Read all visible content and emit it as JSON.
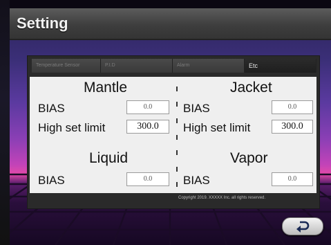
{
  "header": {
    "title": "Setting"
  },
  "tabs": [
    {
      "label": "Temperature Sensor",
      "active": false
    },
    {
      "label": "P.I.D",
      "active": false
    },
    {
      "label": "Alarm",
      "active": false
    },
    {
      "label": "Etc",
      "active": true
    }
  ],
  "mantle": {
    "title": "Mantle",
    "bias_label": "BIAS",
    "bias_value": "0.0",
    "high_label": "High set limit",
    "high_value": "300.0"
  },
  "jacket": {
    "title": "Jacket",
    "bias_label": "BIAS",
    "bias_value": "0.0",
    "high_label": "High set limit",
    "high_value": "300.0"
  },
  "liquid": {
    "title": "Liquid",
    "bias_label": "BIAS",
    "bias_value": "0.0"
  },
  "vapor": {
    "title": "Vapor",
    "bias_label": "BIAS",
    "bias_value": "0.0"
  },
  "footer": {
    "copyright": "Copyright 2019. XXXXX Inc. all rights reserved."
  },
  "icons": {
    "back": "return-arrow-icon"
  }
}
